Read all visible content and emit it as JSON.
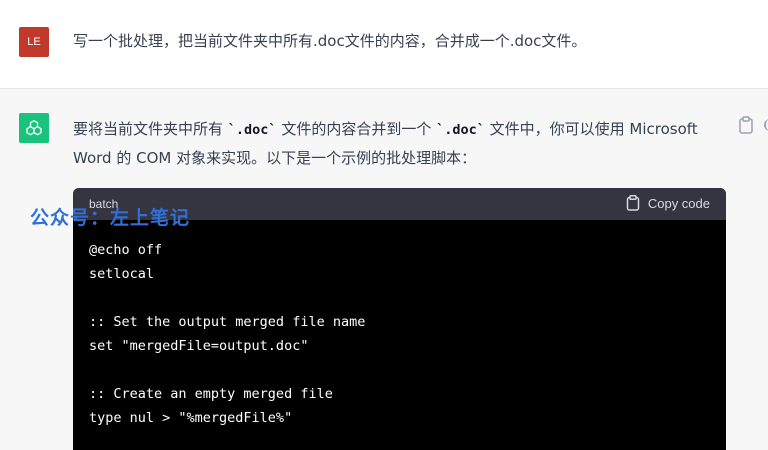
{
  "user": {
    "avatar_initials": "LE",
    "message": "写一个批处理，把当前文件夹中所有.doc文件的内容，合并成一个.doc文件。"
  },
  "assistant": {
    "intro_part1": "要将当前文件夹中所有 ",
    "intro_code1": "`.doc`",
    "intro_part2": " 文件的内容合并到一个 ",
    "intro_code2": "`.doc`",
    "intro_part3": " 文件中，你可以使用 Microsoft Word 的 COM 对象来实现。以下是一个示例的批处理脚本：",
    "code_block": {
      "language": "batch",
      "copy_label": "Copy code",
      "code": "@echo off\nsetlocal\n\n:: Set the output merged file name\nset \"mergedFile=output.doc\"\n\n:: Create an empty merged file\ntype nul > \"%mergedFile%\""
    }
  },
  "watermark": "公众号：左上笔记",
  "colors": {
    "user_avatar": "#c0392b",
    "bot_avatar": "#19c37d",
    "code_bg": "#000000",
    "code_header_bg": "#343541",
    "watermark": "#2f6fd6"
  }
}
